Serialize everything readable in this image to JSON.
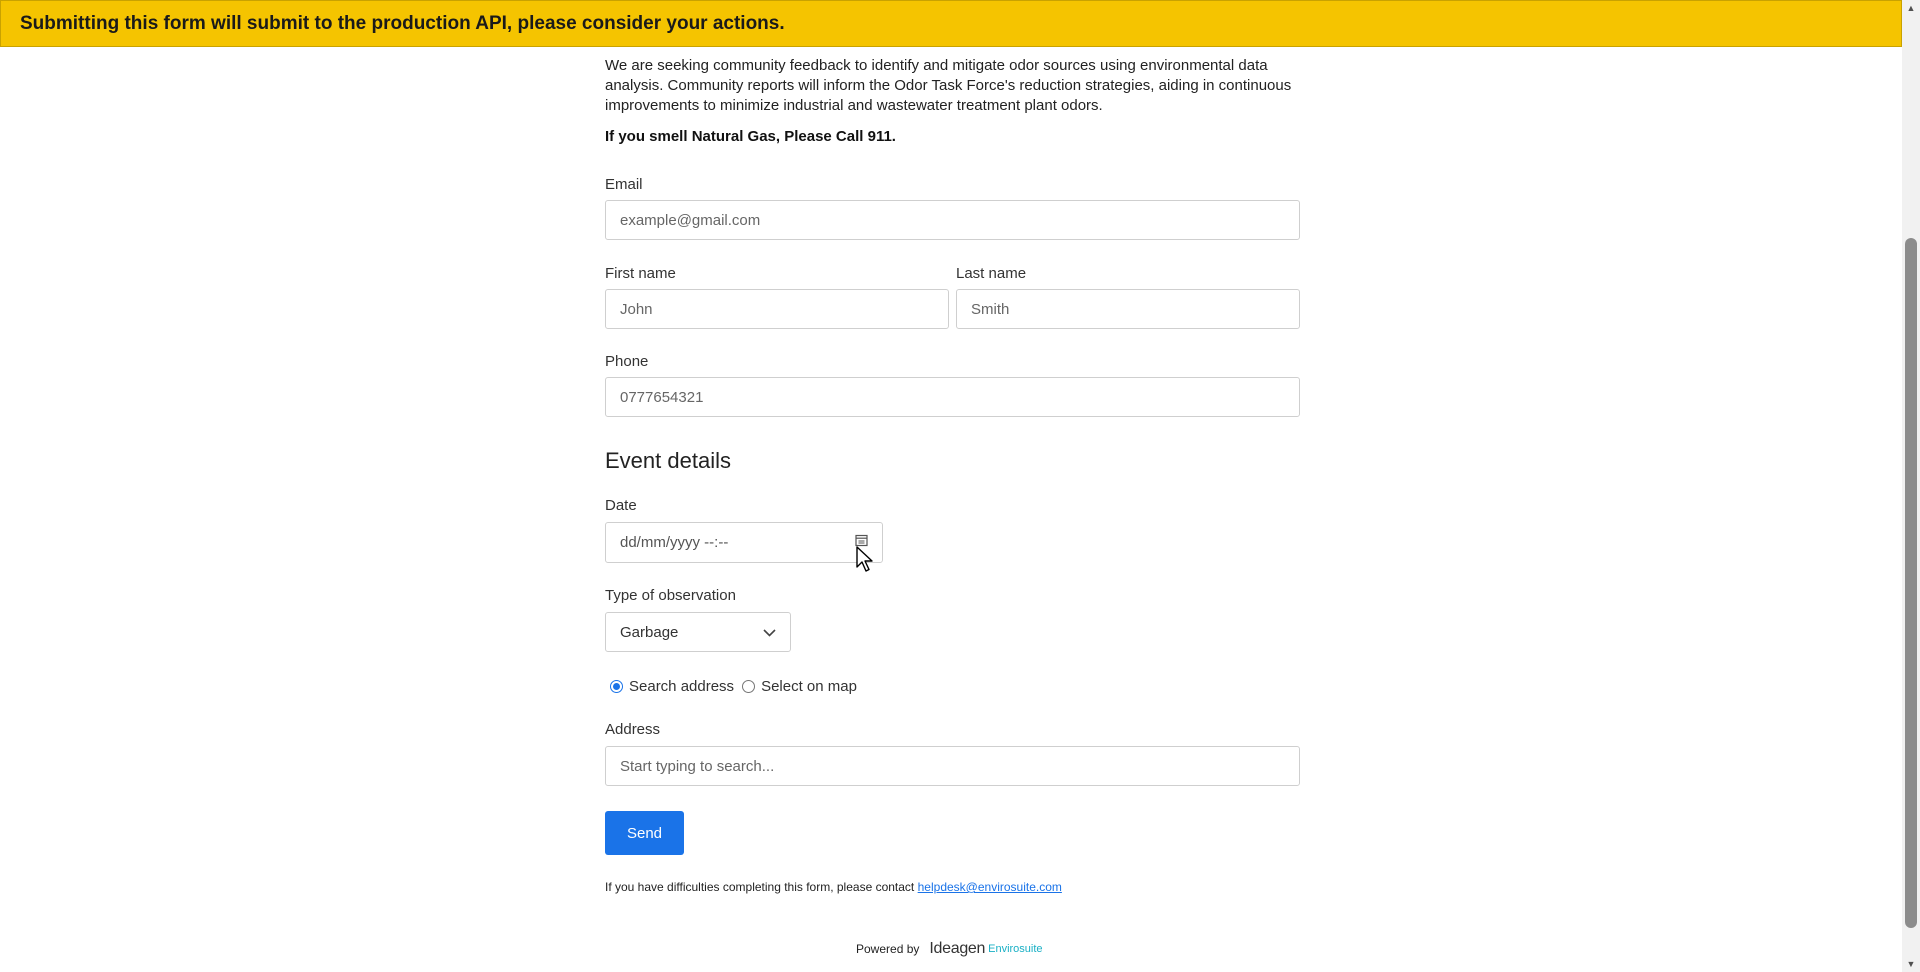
{
  "banner": {
    "text": "Submitting this form will submit to the production API, please consider your actions."
  },
  "intro": {
    "text": "We are seeking community feedback to identify and mitigate odor sources using environmental data analysis. Community reports will inform the Odor Task Force's reduction strategies, aiding in continuous improvements to minimize industrial and wastewater treatment plant odors.",
    "warning": "If you smell Natural Gas, Please Call 911."
  },
  "contact": {
    "email_label": "Email",
    "email_placeholder": "example@gmail.com",
    "first_name_label": "First name",
    "first_name_placeholder": "John",
    "last_name_label": "Last name",
    "last_name_placeholder": "Smith",
    "phone_label": "Phone",
    "phone_placeholder": "0777654321"
  },
  "event": {
    "title": "Event details",
    "date_label": "Date",
    "date_placeholder": "dd/mm/yyyy --:--",
    "type_label": "Type of observation",
    "type_value": "Garbage",
    "radio_search": "Search address",
    "radio_map": "Select on map",
    "address_label": "Address",
    "address_placeholder": "Start typing to search..."
  },
  "actions": {
    "send_label": "Send"
  },
  "footer": {
    "help_text": "If you have difficulties completing this form, please contact",
    "help_email": "helpdesk@envirosuite.com",
    "powered_by": "Powered by",
    "brand": "Ideagen",
    "brand_sub": "Envirosuite"
  },
  "colors": {
    "banner": "#f5c400",
    "primary": "#1a73e8",
    "brand_accent": "#1ab0c5"
  }
}
